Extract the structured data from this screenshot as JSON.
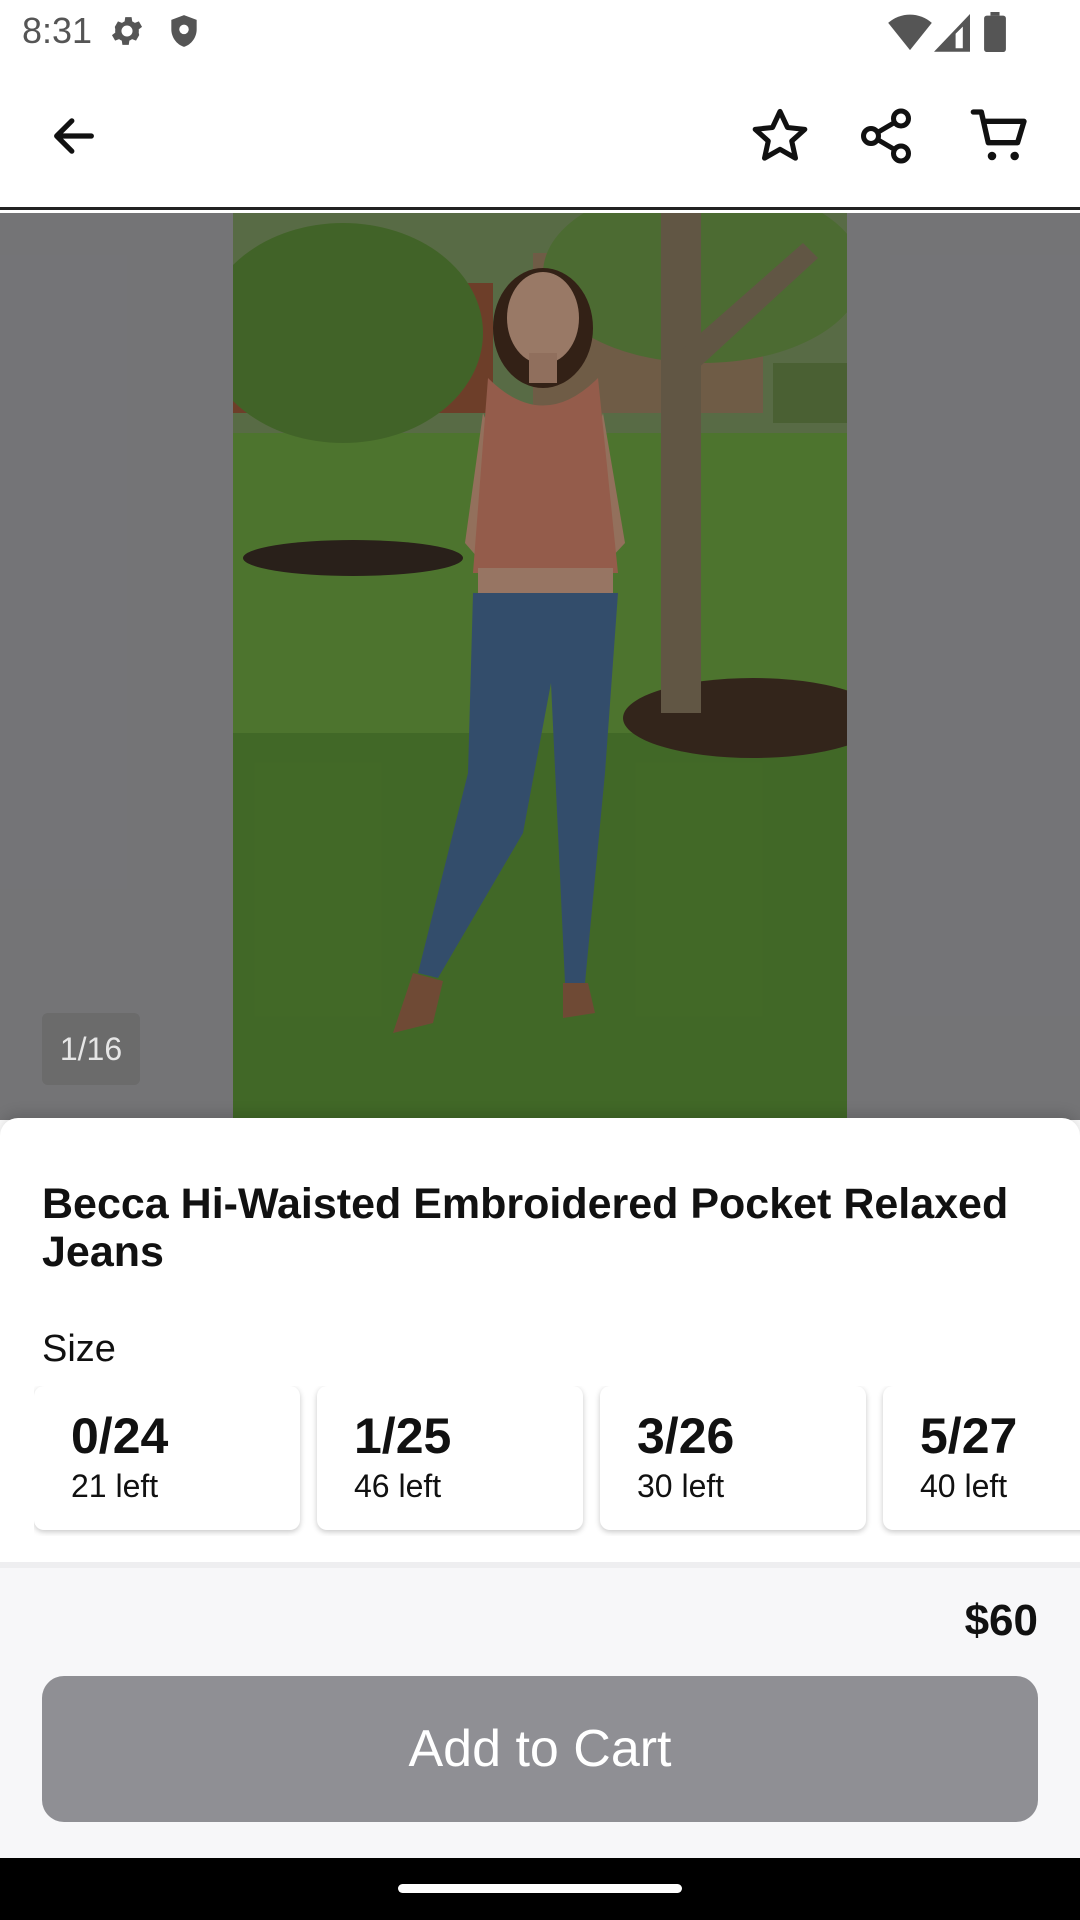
{
  "status_bar": {
    "time": "8:31",
    "icons": [
      "gear-icon",
      "shield-icon",
      "wifi-icon",
      "signal-icon",
      "battery-icon"
    ]
  },
  "app_bar": {
    "icons": [
      "back-arrow-icon",
      "star-icon",
      "share-icon",
      "cart-icon"
    ]
  },
  "gallery": {
    "counter": "1/16"
  },
  "product": {
    "title": "Becca Hi-Waisted Embroidered Pocket Relaxed Jeans",
    "size_label": "Size",
    "sizes": [
      {
        "size": "0/24",
        "stock": "21 left"
      },
      {
        "size": "1/25",
        "stock": "46 left"
      },
      {
        "size": "3/26",
        "stock": "30 left"
      },
      {
        "size": "5/27",
        "stock": "40 left"
      }
    ],
    "price": "$60",
    "add_to_cart_label": "Add to Cart"
  },
  "colors": {
    "button_disabled": "#8f8f94",
    "overlay_grey": "#a6a6aa",
    "top_pink": "#d4856c",
    "denim": "#4a6f9a"
  }
}
